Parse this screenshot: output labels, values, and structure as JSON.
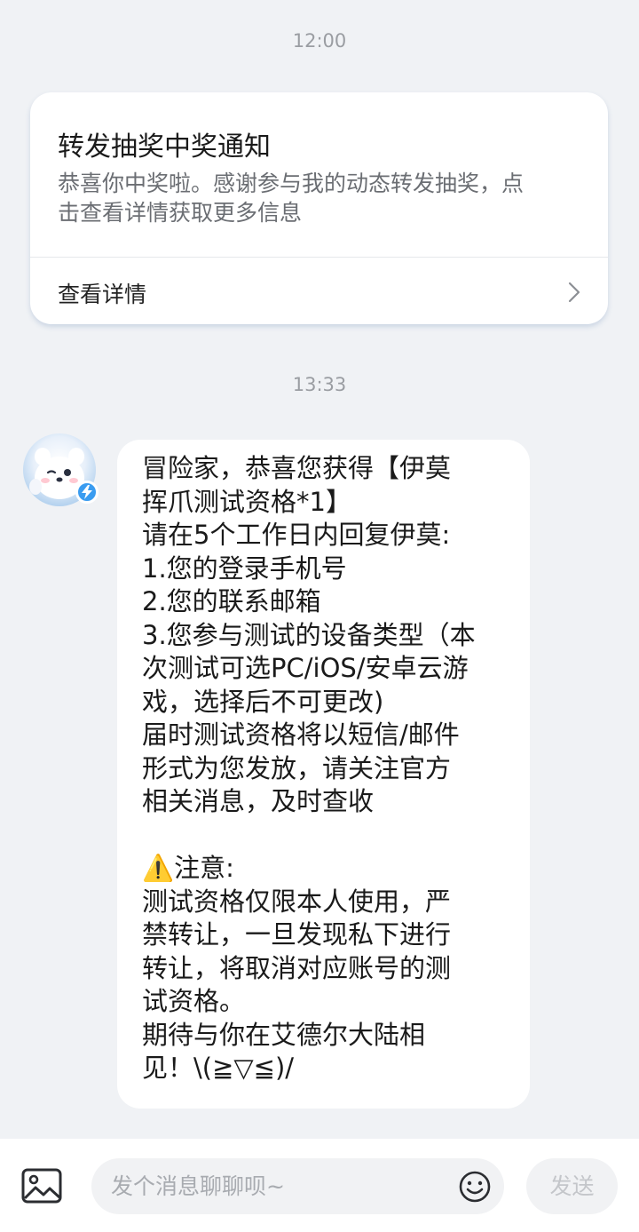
{
  "timestamps": [
    "12:00",
    "13:33"
  ],
  "notice_card": {
    "title": "转发抽奖中奖通知",
    "description_lines": [
      "恭喜你中奖啦。感谢参与我的动态转发抽奖，点",
      "击查看详情获取更多信息"
    ],
    "detail_link": "查看详情"
  },
  "message": {
    "avatar_icon": "white-mascot-avatar",
    "badge_icon": "lightning-badge-icon",
    "lines": [
      "冒险家，恭喜您获得【伊莫",
      "挥爪测试资格*1】",
      "请在5个工作日内回复伊莫:",
      "1.您的登录手机号",
      "2.您的联系邮箱",
      "3.您参与测试的设备类型（本",
      "次测试可选PC/iOS/安卓云游",
      "戏，选择后不可更改)",
      "届时测试资格将以短信/邮件",
      "形式为您发放，请关注官方",
      "相关消息，及时查收",
      "",
      "⚠️注意:",
      "测试资格仅限本人使用，严",
      "禁转让，一旦发现私下进行",
      "转让，将取消对应账号的测",
      "试资格。",
      "期待与你在艾德尔大陆相",
      "见！\\(≧▽≦)/"
    ]
  },
  "composer": {
    "image_icon": "image-icon",
    "placeholder": "发个消息聊聊呗~",
    "emoji_icon": "emoji-icon",
    "send_label": "发送"
  },
  "colors": {
    "background": "#f0f2f5",
    "card_bg": "#ffffff",
    "badge": "#3a9cf0",
    "muted_text": "#9a9da2"
  }
}
